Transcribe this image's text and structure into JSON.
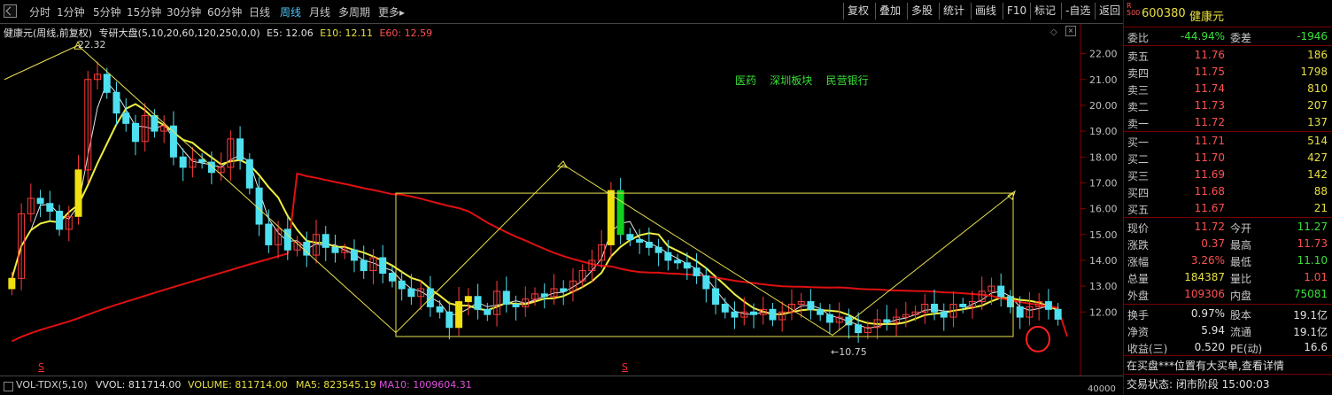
{
  "toolbar": {
    "tabs": [
      "分时",
      "1分钟",
      "5分钟",
      "15分钟",
      "30分钟",
      "60分钟",
      "日线",
      "周线",
      "月线",
      "多周期",
      "更多▸"
    ],
    "active_tab": "周线",
    "buttons": [
      "复权",
      "叠加",
      "多股",
      "统计",
      "画线",
      "F10",
      "标记",
      "-自选",
      "返回"
    ]
  },
  "info_line": {
    "stock_label": "健康元(周线,前复权)",
    "indicator": "专研大盘(5,10,20,60,120,250,0,0)",
    "e5": "E5: 12.06",
    "e10": "E10: 12.11",
    "e60": "E60: 12.59"
  },
  "annotations": {
    "high_label": "22.32",
    "low_label": "←10.75",
    "sectors": [
      "医药",
      "深圳板块",
      "民营银行"
    ],
    "s_marker": "S"
  },
  "axis": {
    "ticks": [
      "22.00",
      "21.00",
      "20.00",
      "19.00",
      "18.00",
      "17.00",
      "16.00",
      "15.00",
      "14.00",
      "13.00",
      "12.00"
    ],
    "vol_tick": "40000"
  },
  "volume_bar": {
    "name": "VOL-TDX(5,10)",
    "vvol": "VVOL: 811714.00",
    "volume": "VOLUME: 811714.00",
    "ma5": "MA5: 823545.19",
    "ma10": "MA10: 1009604.31"
  },
  "panel": {
    "badge_r": "R",
    "badge_500": "500",
    "code": "600380",
    "name": "健康元",
    "weibi_label": "委比",
    "weibi_value": "-44.94%",
    "weicha_label": "委差",
    "weicha_value": "-1946",
    "asks": [
      {
        "label": "卖五",
        "price": "11.76",
        "vol": "186"
      },
      {
        "label": "卖四",
        "price": "11.75",
        "vol": "1798"
      },
      {
        "label": "卖三",
        "price": "11.74",
        "vol": "810"
      },
      {
        "label": "卖二",
        "price": "11.73",
        "vol": "207"
      },
      {
        "label": "卖一",
        "price": "11.72",
        "vol": "137"
      }
    ],
    "bids": [
      {
        "label": "买一",
        "price": "11.71",
        "vol": "514"
      },
      {
        "label": "买二",
        "price": "11.70",
        "vol": "427"
      },
      {
        "label": "买三",
        "price": "11.69",
        "vol": "142"
      },
      {
        "label": "买四",
        "price": "11.68",
        "vol": "88"
      },
      {
        "label": "买五",
        "price": "11.67",
        "vol": "21"
      }
    ],
    "stats": [
      {
        "l1": "现价",
        "v1": "11.72",
        "c1": "red",
        "l2": "今开",
        "v2": "11.27",
        "c2": "green"
      },
      {
        "l1": "涨跌",
        "v1": "0.37",
        "c1": "red",
        "l2": "最高",
        "v2": "11.73",
        "c2": "red"
      },
      {
        "l1": "涨幅",
        "v1": "3.26%",
        "c1": "red",
        "l2": "最低",
        "v2": "11.10",
        "c2": "green"
      },
      {
        "l1": "总量",
        "v1": "184387",
        "c1": "yellow",
        "l2": "量比",
        "v2": "1.01",
        "c2": "red"
      },
      {
        "l1": "外盘",
        "v1": "109306",
        "c1": "red",
        "l2": "内盘",
        "v2": "75081",
        "c2": "green"
      }
    ],
    "stats2": [
      {
        "l1": "换手",
        "v1": "0.97%",
        "l2": "股本",
        "v2": "19.1亿"
      },
      {
        "l1": "净资",
        "v1": "5.94",
        "l2": "流通",
        "v2": "19.1亿"
      },
      {
        "l1": "收益(三)",
        "v1": "0.520",
        "l2": "PE(动)",
        "v2": "16.6"
      }
    ],
    "notice": "在买盘***位置有大买单,查看详情",
    "status": "交易状态: 闭市阶段 15:00:03"
  },
  "colors": {
    "up": "#ff3b3b",
    "down": "#4fe0f0",
    "ma_yellow": "#f0f040",
    "ma_red": "#e01010",
    "box": "#e8e050"
  }
}
